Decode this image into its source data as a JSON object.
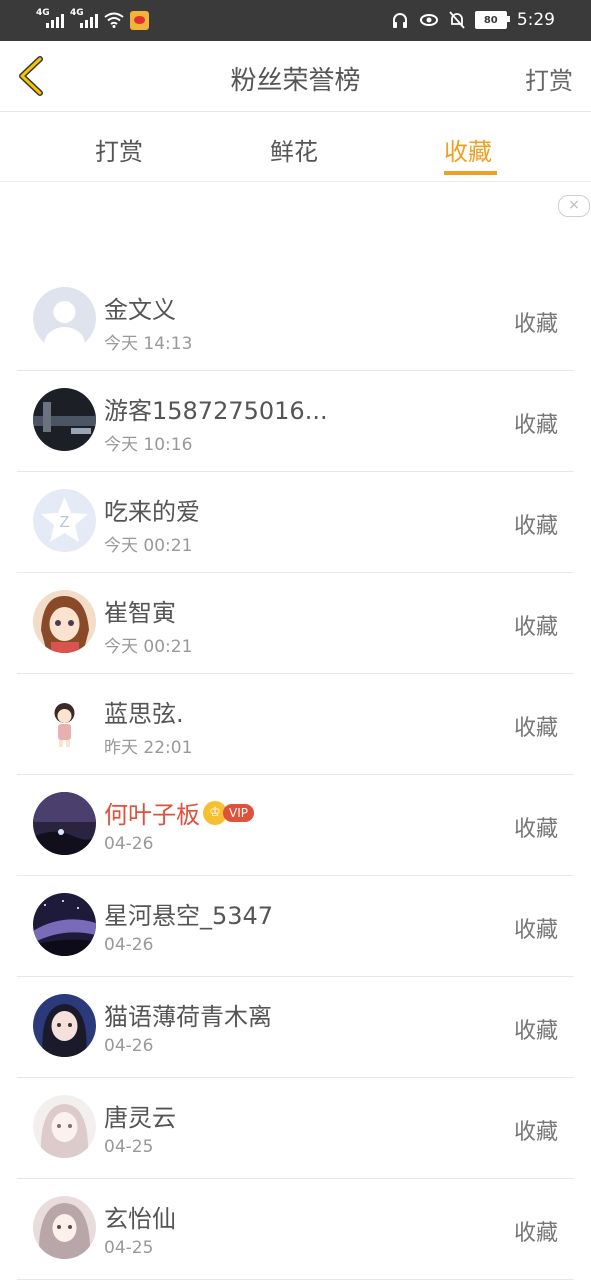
{
  "status_bar": {
    "signal1": "4G",
    "signal2": "4G",
    "battery": "80",
    "time": "5:29"
  },
  "nav": {
    "back_icon": "chevron-left-icon",
    "title": "粉丝荣誉榜",
    "right_label": "打赏"
  },
  "tabs": [
    {
      "label": "打赏"
    },
    {
      "label": "鲜花"
    },
    {
      "label": "收藏",
      "active": true
    }
  ],
  "ad": {
    "close_icon": "close-icon",
    "close_glyph": "×"
  },
  "list": [
    {
      "name": "金文义",
      "time": "今天 14:13",
      "action": "收藏",
      "avatar": "default-avatar"
    },
    {
      "name": "游客1587275016...",
      "time": "今天 10:16",
      "action": "收藏",
      "avatar": "dark-photo-avatar"
    },
    {
      "name": "吃来的爱",
      "time": "今天 00:21",
      "action": "收藏",
      "avatar": "qq-avatar"
    },
    {
      "name": "崔智寅",
      "time": "今天 00:21",
      "action": "收藏",
      "avatar": "anime-girl-avatar"
    },
    {
      "name": "蓝思弦.",
      "time": "昨天 22:01",
      "action": "收藏",
      "avatar": "chibi-avatar"
    },
    {
      "name": "何叶子板",
      "time": "04-26",
      "action": "收藏",
      "avatar": "night-sky-avatar",
      "vip": true,
      "vip_label": "VIP",
      "crown_glyph": "♔"
    },
    {
      "name": "星河悬空_5347",
      "time": "04-26",
      "action": "收藏",
      "avatar": "galaxy-avatar"
    },
    {
      "name": "猫语薄荷青木离",
      "time": "04-26",
      "action": "收藏",
      "avatar": "girl-blue-avatar"
    },
    {
      "name": "唐灵云",
      "time": "04-25",
      "action": "收藏",
      "avatar": "sketch-girl-avatar"
    },
    {
      "name": "玄怡仙",
      "time": "04-25",
      "action": "收藏",
      "avatar": "ancient-girl-avatar"
    }
  ],
  "colors": {
    "accent": "#f0a020",
    "vip": "#e0503a",
    "status_bar": "#3a3a3a"
  }
}
